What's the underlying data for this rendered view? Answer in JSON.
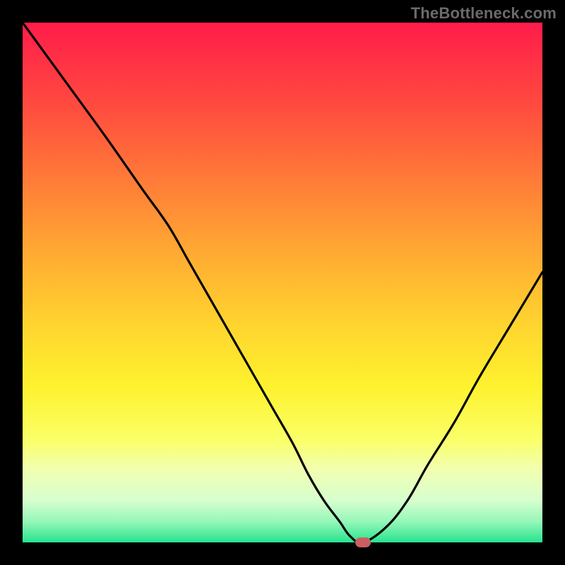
{
  "watermark": "TheBottleneck.com",
  "colors": {
    "frame": "#000000",
    "curve": "#000000",
    "marker": "#cc5d60",
    "gradient_top": "#ff1c4a",
    "gradient_bottom": "#27e38f"
  },
  "chart_data": {
    "type": "line",
    "title": "",
    "xlabel": "",
    "ylabel": "",
    "xlim": [
      0,
      100
    ],
    "ylim": [
      0,
      100
    ],
    "grid": false,
    "series": [
      {
        "name": "bottleneck-curve",
        "x": [
          0,
          8,
          16,
          23,
          28,
          32,
          36,
          40,
          44,
          48,
          52,
          55,
          58,
          61,
          63,
          65.5,
          70,
          74,
          78,
          83,
          88,
          94,
          100
        ],
        "values": [
          100,
          89,
          78,
          68,
          61,
          54,
          47,
          40,
          33,
          26,
          19,
          13,
          8,
          4,
          1.2,
          0,
          3,
          8,
          15,
          23,
          32,
          42,
          52
        ]
      }
    ],
    "marker": {
      "x": 65.5,
      "y": 0
    }
  }
}
